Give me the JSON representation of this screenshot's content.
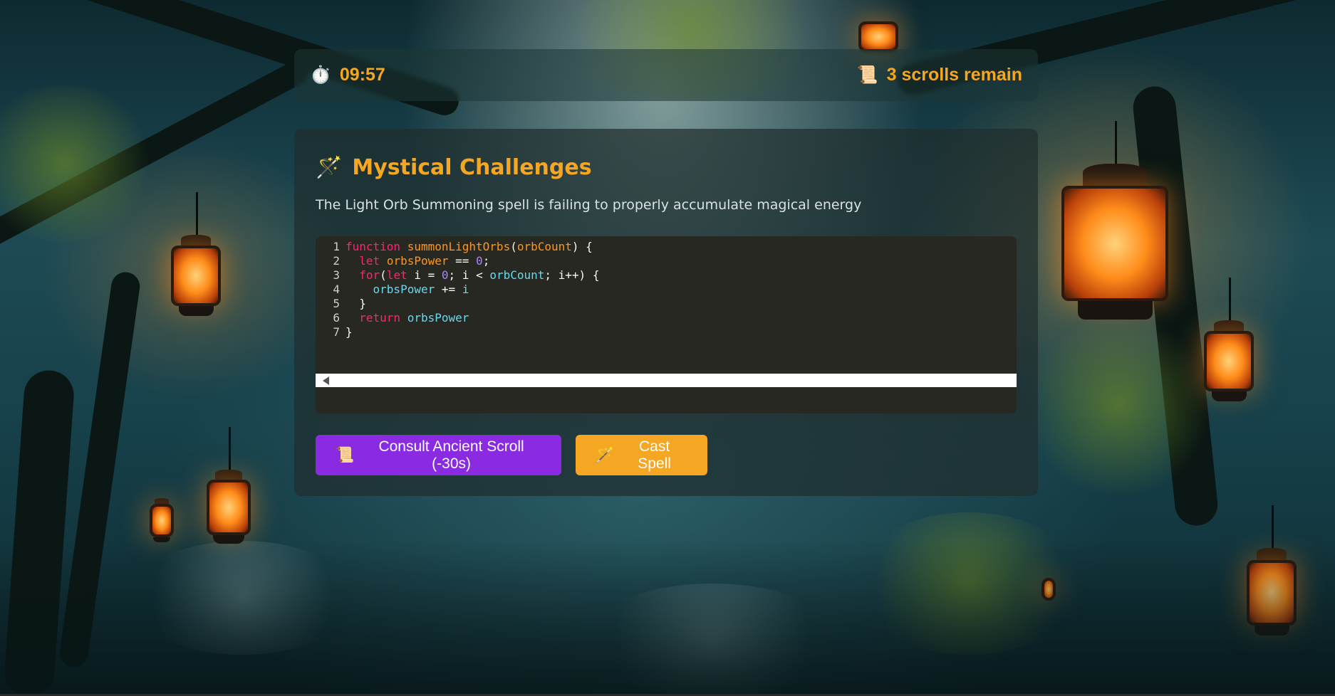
{
  "timer": {
    "icon": "stopwatch-icon",
    "glyph": "⏱️",
    "value": "09:57"
  },
  "scrolls": {
    "icon": "scroll-icon",
    "glyph": "📜",
    "text": "3 scrolls remain"
  },
  "panel": {
    "icon": "magic-wand-icon",
    "glyph": "🪄",
    "title": "Mystical Challenges",
    "description": "The Light Orb Summoning spell is failing to properly accumulate magical energy"
  },
  "editor": {
    "line_numbers": [
      "1",
      "2",
      "3",
      "4",
      "5",
      "6",
      "7"
    ]
  },
  "buttons": {
    "consult": {
      "glyph": "📜",
      "label": "Consult Ancient Scroll (-30s)",
      "icon": "scroll-icon"
    },
    "cast": {
      "glyph": "🪄",
      "label": "Cast Spell",
      "icon": "magic-wand-icon"
    }
  },
  "colors": {
    "accent": "#f5a623",
    "consult_button": "#8a2be2",
    "editor_bg": "#272822"
  }
}
